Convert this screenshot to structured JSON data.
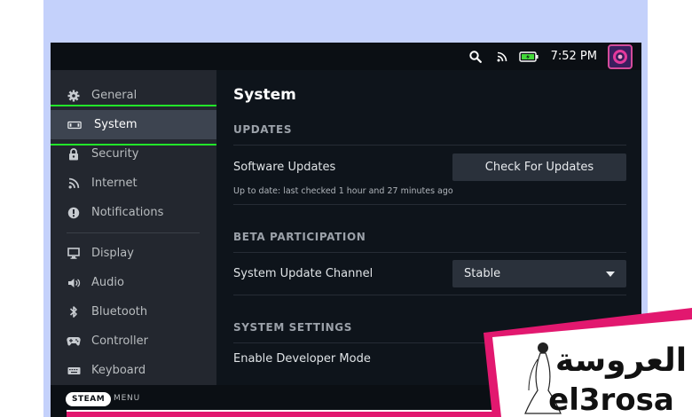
{
  "statusbar": {
    "time": "7:52 PM",
    "icons": [
      "search-icon",
      "rss-icon",
      "battery-icon"
    ]
  },
  "sidebar": {
    "items": [
      {
        "label": "General",
        "icon": "gear-icon"
      },
      {
        "label": "System",
        "icon": "system-icon",
        "active": true
      },
      {
        "label": "Security",
        "icon": "lock-icon"
      },
      {
        "label": "Internet",
        "icon": "wifi-icon"
      },
      {
        "label": "Notifications",
        "icon": "alert-icon"
      },
      {
        "label": "Display",
        "icon": "monitor-icon"
      },
      {
        "label": "Audio",
        "icon": "speaker-icon"
      },
      {
        "label": "Bluetooth",
        "icon": "bluetooth-icon"
      },
      {
        "label": "Controller",
        "icon": "gamepad-icon"
      },
      {
        "label": "Keyboard",
        "icon": "keyboard-icon"
      }
    ]
  },
  "main": {
    "title": "System",
    "updates": {
      "heading": "UPDATES",
      "software_label": "Software Updates",
      "button": "Check For Updates",
      "status": "Up to date: last checked 1 hour and 27 minutes ago"
    },
    "beta": {
      "heading": "BETA PARTICIPATION",
      "channel_label": "System Update Channel",
      "channel_value": "Stable"
    },
    "settings": {
      "heading": "SYSTEM SETTINGS",
      "dev_mode_label": "Enable Developer Mode"
    }
  },
  "bottombar": {
    "steam": "STEAM",
    "menu": "MENU"
  },
  "watermark": {
    "arabic": "العروسة",
    "latin": "el3rosa"
  },
  "colors": {
    "highlight": "#22e52a",
    "banner_pink": "#e2186f",
    "lavender": "#c4d1fb"
  }
}
